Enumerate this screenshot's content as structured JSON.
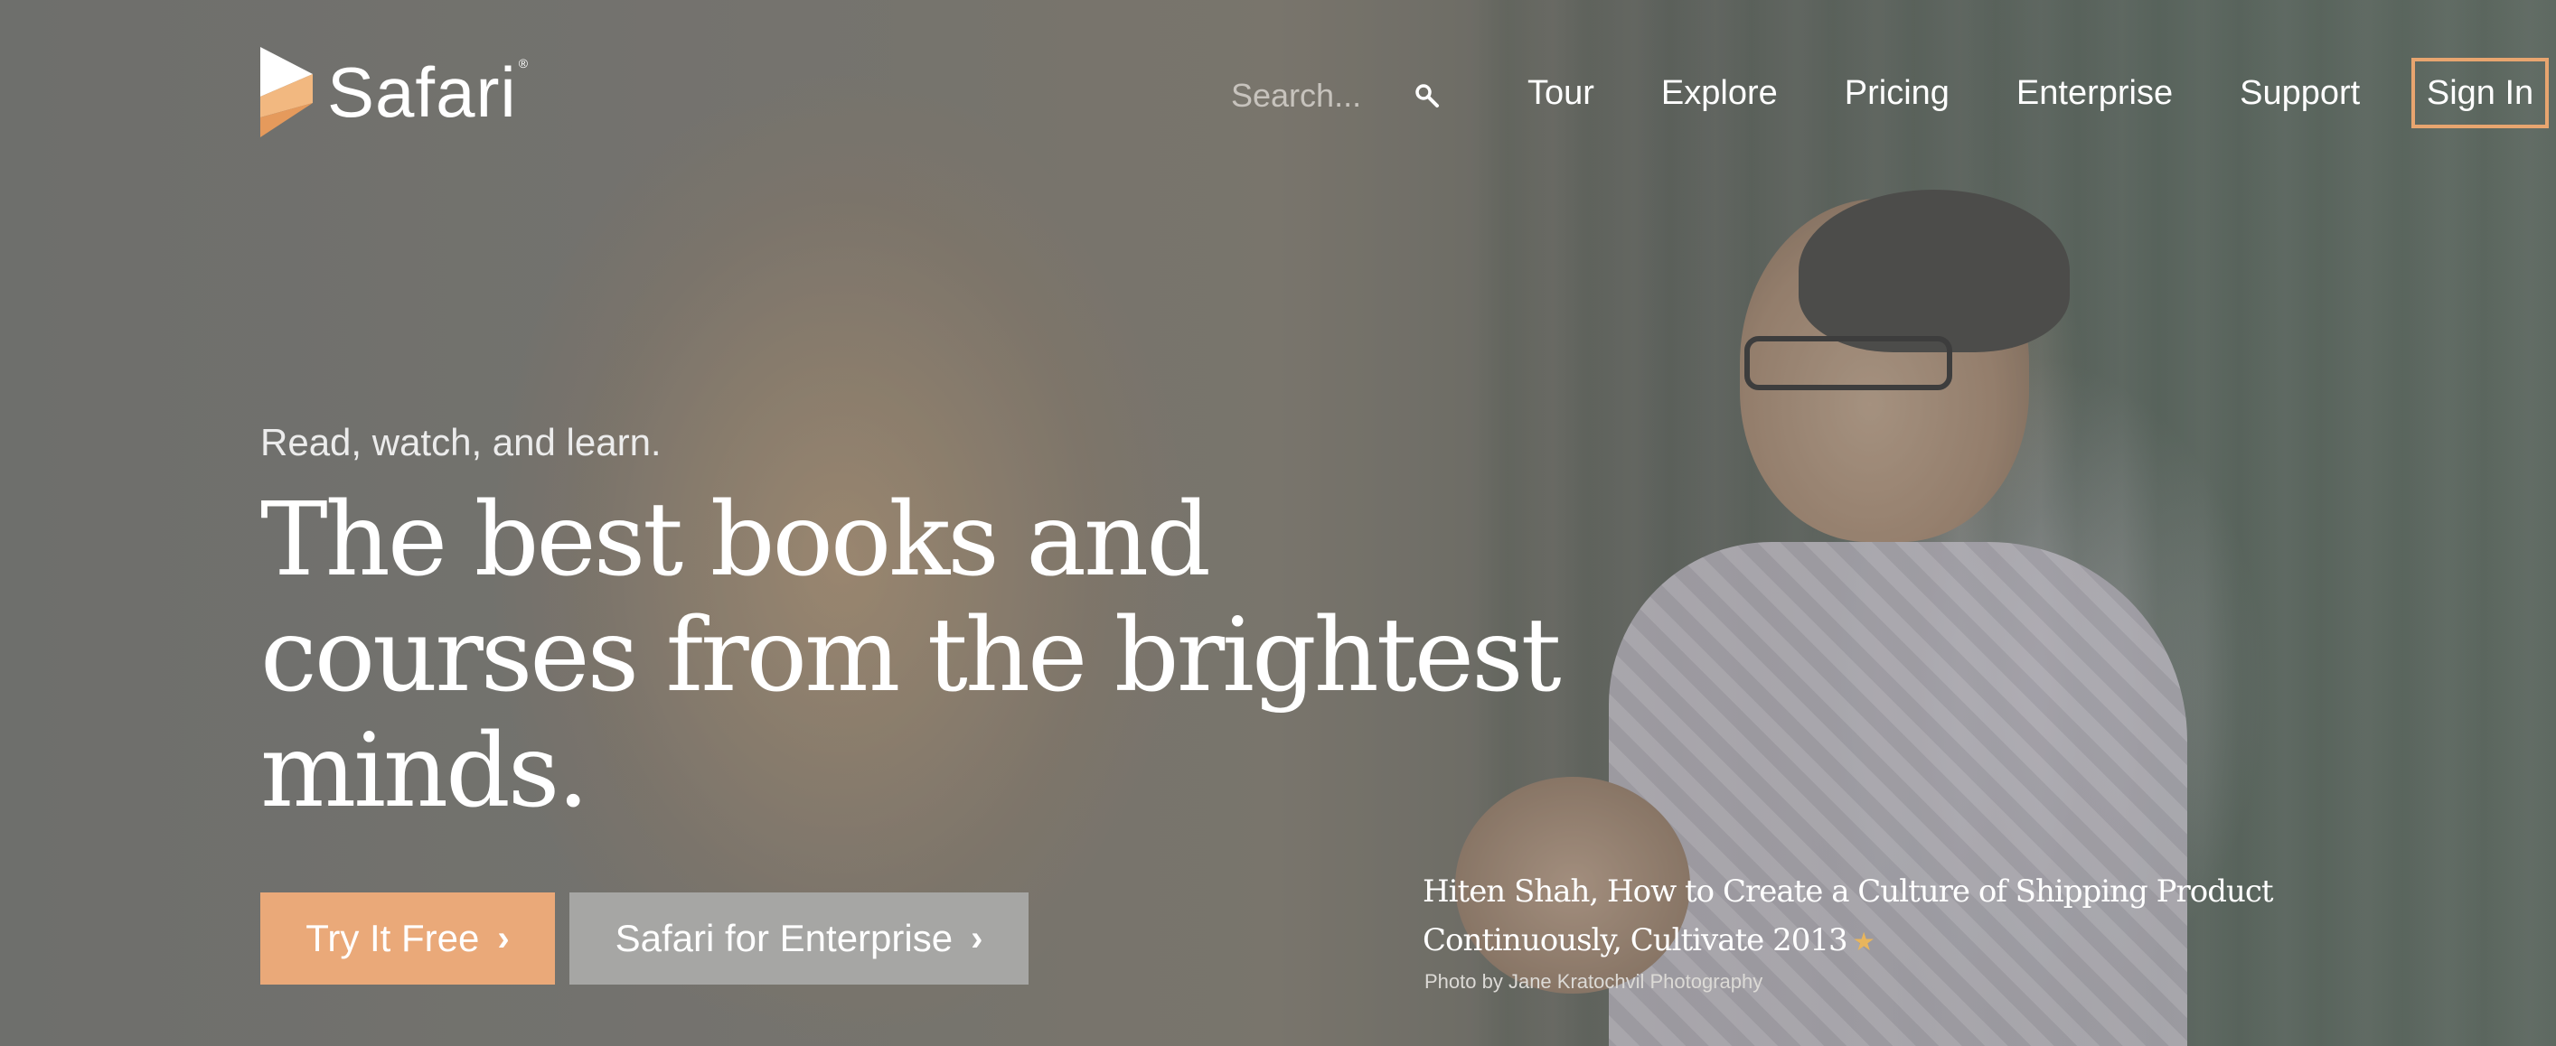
{
  "header": {
    "logo_text": "Safari",
    "logo_mark": "®",
    "search": {
      "placeholder": "Search..."
    },
    "nav": [
      {
        "label": "Tour"
      },
      {
        "label": "Explore"
      },
      {
        "label": "Pricing"
      },
      {
        "label": "Enterprise"
      },
      {
        "label": "Support"
      }
    ],
    "sign_in": "Sign In"
  },
  "hero": {
    "tagline": "Read, watch, and learn.",
    "headline_lines": [
      "The best books and",
      "courses from the brightest",
      "minds."
    ],
    "cta_primary": "Try It Free",
    "cta_secondary": "Safari for Enterprise",
    "caption_lines": [
      "Hiten Shah, How to Create a Culture of Shipping Product",
      "Continuously, Cultivate 2013"
    ],
    "credit": "Photo by Jane Kratochvil Photography"
  },
  "colors": {
    "accent": "#eaa979",
    "secondary_button": "#a6a6a4",
    "sign_in_border": "#e8a56f"
  },
  "icons": [
    "safari-logo-icon",
    "search-icon",
    "chevron-right-icon",
    "star-icon"
  ]
}
